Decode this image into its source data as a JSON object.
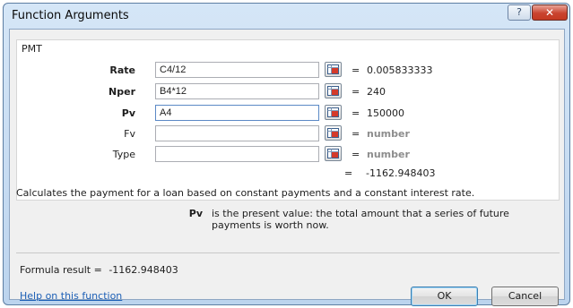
{
  "window": {
    "title": "Function Arguments",
    "help_glyph": "?",
    "close_glyph": "✕"
  },
  "function": {
    "name": "PMT",
    "description": "Calculates the payment for a loan based on constant payments and a constant interest rate."
  },
  "arguments": [
    {
      "label": "Rate",
      "required": true,
      "value": "C4/12",
      "result": "0.005833333"
    },
    {
      "label": "Nper",
      "required": true,
      "value": "B4*12",
      "result": "240"
    },
    {
      "label": "Pv",
      "required": true,
      "value": "A4",
      "result": "150000"
    },
    {
      "label": "Fv",
      "required": false,
      "value": "",
      "result": "number"
    },
    {
      "label": "Type",
      "required": false,
      "value": "",
      "result": "number"
    }
  ],
  "equals_sign": "=",
  "function_result": "-1162.948403",
  "arg_help": {
    "name": "Pv",
    "text": "is the present value: the total amount that a series of future payments is worth now."
  },
  "formula_result": {
    "label": "Formula result =",
    "value": "-1162.948403"
  },
  "help_link": "Help on this function",
  "buttons": {
    "ok": "OK",
    "cancel": "Cancel"
  },
  "colors": {
    "titlebar": "#bcd4ee",
    "close_button": "#c9432f",
    "link": "#1c5fb6",
    "placeholder_text": "#8d8d8d"
  }
}
